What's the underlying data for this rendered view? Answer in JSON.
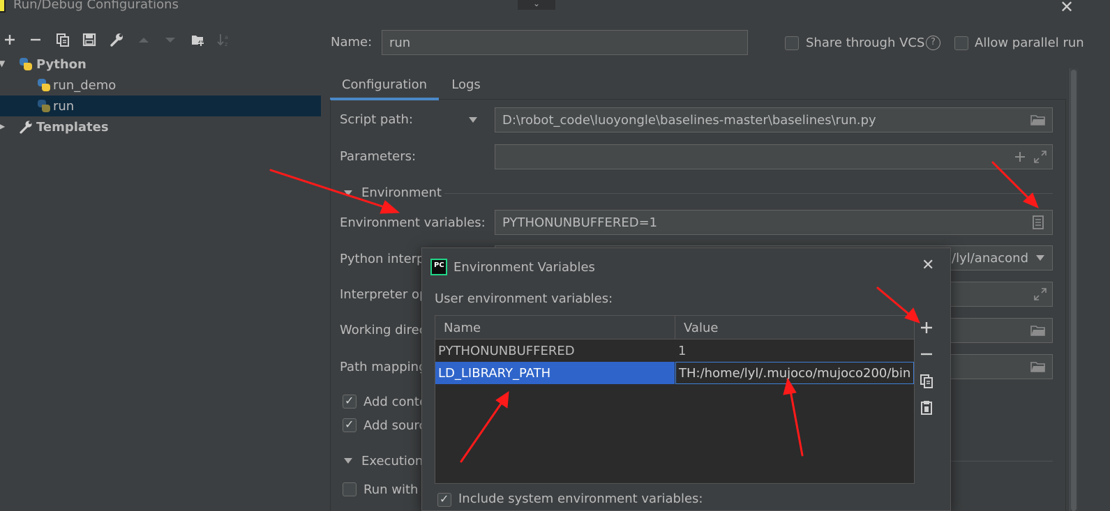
{
  "window": {
    "title": "Run/Debug Configurations",
    "close_glyph": "✕",
    "dropdown_glyph": "⌄"
  },
  "toolbar": {
    "buttons": [
      "add-icon",
      "remove-icon",
      "copy-icon",
      "save-icon",
      "wrench-icon",
      "move-up-icon",
      "move-down-icon",
      "new-folder-icon",
      "sort-icon"
    ]
  },
  "tree": {
    "python": "Python",
    "run_demo": "run_demo",
    "run": "run",
    "templates": "Templates"
  },
  "header": {
    "name_label": "Name:",
    "name_value": "run",
    "share_label": "Share through VCS",
    "help_glyph": "?",
    "parallel_label": "Allow parallel run"
  },
  "tabs": {
    "configuration": "Configuration",
    "logs": "Logs"
  },
  "config": {
    "script_path_label": "Script path:",
    "script_path_value": "D:\\robot_code\\luoyongle\\baselines-master\\baselines\\run.py",
    "parameters_label": "Parameters:",
    "parameters_value": "",
    "environment_section": "Environment",
    "env_vars_label": "Environment variables:",
    "env_vars_value": "PYTHONUNBUFFERED=1",
    "interpreter_label": "Python interp",
    "interpreter_value": "/lyl/anacond",
    "interpreter_options_label": "Interpreter op",
    "working_dir_label": "Working direc",
    "path_mappings_label": "Path mapping",
    "add_content_label": "Add conte",
    "add_source_label": "Add sourc",
    "execution_section": "Execution",
    "run_with_label": "Run with I"
  },
  "env_dialog": {
    "icon_text": "PC",
    "title": "Environment Variables",
    "close_glyph": "✕",
    "subtitle": "User environment variables:",
    "columns": [
      "Name",
      "Value"
    ],
    "rows": [
      {
        "name": "PYTHONUNBUFFERED",
        "value": "1"
      },
      {
        "name": "LD_LIBRARY_PATH",
        "value": "TH:/home/lyl/.mujoco/mujoco200/bin"
      }
    ],
    "include_system_label": "Include system environment variables:"
  },
  "colors": {
    "background": "#3c3f41",
    "selection": "#2f65ca",
    "tab_underline": "#4a88c7",
    "annotation_arrow": "#ff1a1a"
  }
}
